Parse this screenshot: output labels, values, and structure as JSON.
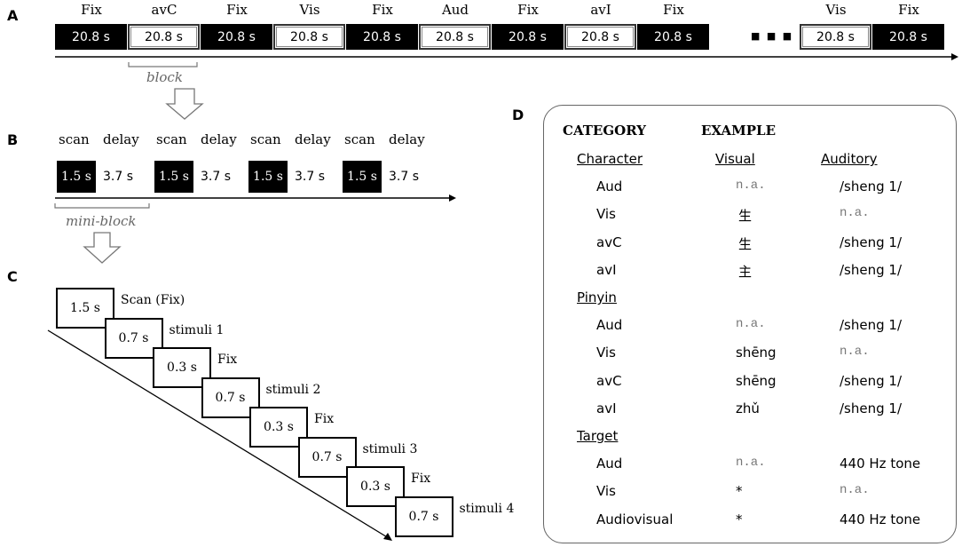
{
  "panels": {
    "a": {
      "letter": "A"
    },
    "b": {
      "letter": "B"
    },
    "c": {
      "letter": "C"
    },
    "d": {
      "letter": "D"
    }
  },
  "panel_a": {
    "blocks": [
      {
        "label": "Fix",
        "duration": "20.8 s",
        "style": "dark"
      },
      {
        "label": "avC",
        "duration": "20.8 s",
        "style": "light"
      },
      {
        "label": "Fix",
        "duration": "20.8 s",
        "style": "dark"
      },
      {
        "label": "Vis",
        "duration": "20.8 s",
        "style": "light"
      },
      {
        "label": "Fix",
        "duration": "20.8 s",
        "style": "dark"
      },
      {
        "label": "Aud",
        "duration": "20.8 s",
        "style": "light"
      },
      {
        "label": "Fix",
        "duration": "20.8 s",
        "style": "dark"
      },
      {
        "label": "avI",
        "duration": "20.8 s",
        "style": "light"
      },
      {
        "label": "Fix",
        "duration": "20.8 s",
        "style": "dark"
      },
      {
        "label": "Vis",
        "duration": "20.8 s",
        "style": "light"
      },
      {
        "label": "Fix",
        "duration": "20.8 s",
        "style": "dark"
      }
    ],
    "ellipsis": "■ ■ ■",
    "bracket_label": "block"
  },
  "panel_b": {
    "mini_blocks": [
      {
        "scan_label": "scan",
        "delay_label": "delay",
        "scan_duration": "1.5 s",
        "delay_duration": "3.7 s"
      },
      {
        "scan_label": "scan",
        "delay_label": "delay",
        "scan_duration": "1.5 s",
        "delay_duration": "3.7 s"
      },
      {
        "scan_label": "scan",
        "delay_label": "delay",
        "scan_duration": "1.5 s",
        "delay_duration": "3.7 s"
      },
      {
        "scan_label": "scan",
        "delay_label": "delay",
        "scan_duration": "1.5 s",
        "delay_duration": "3.7 s"
      }
    ],
    "bracket_label": "mini-block"
  },
  "panel_c": {
    "frames": [
      {
        "duration": "1.5 s",
        "label": "Scan (Fix)"
      },
      {
        "duration": "0.7 s",
        "label": "stimuli 1"
      },
      {
        "duration": "0.3 s",
        "label": "Fix"
      },
      {
        "duration": "0.7 s",
        "label": "stimuli 2"
      },
      {
        "duration": "0.3 s",
        "label": "Fix"
      },
      {
        "duration": "0.7 s",
        "label": "stimuli 3"
      },
      {
        "duration": "0.3 s",
        "label": "Fix"
      },
      {
        "duration": "0.7 s",
        "label": "stimuli 4"
      }
    ]
  },
  "panel_d": {
    "header_category": "CATEGORY",
    "header_example": "EXAMPLE",
    "col_visual": "Visual",
    "col_auditory": "Auditory",
    "groups": [
      {
        "name": "Character",
        "rows": [
          {
            "cond": "Aud",
            "visual": "n.a.",
            "auditory": "/sheng 1/",
            "visual_na": true,
            "auditory_na": false
          },
          {
            "cond": "Vis",
            "visual": "生",
            "auditory": "n.a.",
            "visual_na": false,
            "auditory_na": true
          },
          {
            "cond": "avC",
            "visual": "生",
            "auditory": "/sheng 1/",
            "visual_na": false,
            "auditory_na": false
          },
          {
            "cond": "avI",
            "visual": "主",
            "auditory": "/sheng 1/",
            "visual_na": false,
            "auditory_na": false
          }
        ]
      },
      {
        "name": "Pinyin",
        "rows": [
          {
            "cond": "Aud",
            "visual": "n.a.",
            "auditory": "/sheng 1/",
            "visual_na": true,
            "auditory_na": false
          },
          {
            "cond": "Vis",
            "visual": "shēng",
            "auditory": "n.a.",
            "visual_na": false,
            "auditory_na": true
          },
          {
            "cond": "avC",
            "visual": "shēng",
            "auditory": "/sheng 1/",
            "visual_na": false,
            "auditory_na": false
          },
          {
            "cond": "avI",
            "visual": "zhǔ",
            "auditory": "/sheng 1/",
            "visual_na": false,
            "auditory_na": false
          }
        ]
      },
      {
        "name": "Target",
        "rows": [
          {
            "cond": "Aud",
            "visual": "n.a.",
            "auditory": "440 Hz tone",
            "visual_na": true,
            "auditory_na": false
          },
          {
            "cond": "Vis",
            "visual": "*",
            "auditory": "n.a.",
            "visual_na": false,
            "auditory_na": true
          },
          {
            "cond": "Audiovisual",
            "visual": "*",
            "auditory": "440 Hz tone",
            "visual_na": false,
            "auditory_na": false
          }
        ]
      }
    ]
  }
}
